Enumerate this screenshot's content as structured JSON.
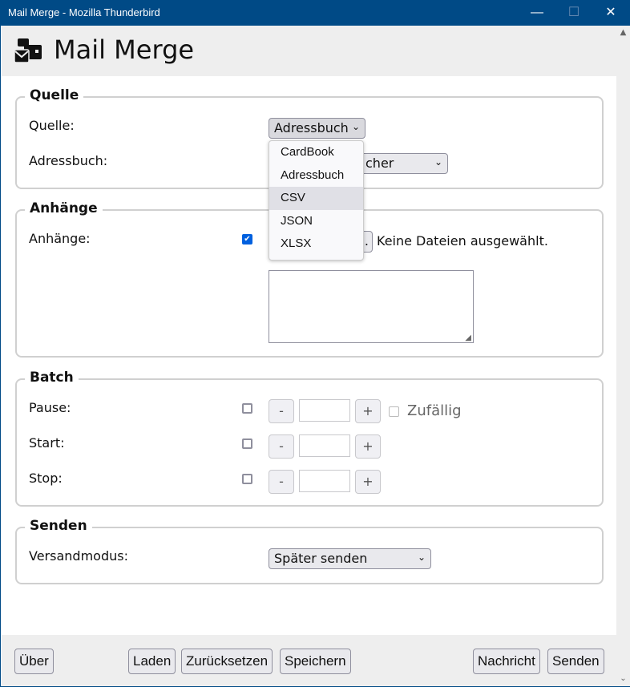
{
  "window": {
    "title": "Mail Merge - Mozilla Thunderbird",
    "minimize": "—",
    "maximize": "☐",
    "close": "✕"
  },
  "header": {
    "title": "Mail Merge",
    "icon": "mail-merge-icon"
  },
  "quelle": {
    "legend": "Quelle",
    "source_label": "Quelle:",
    "source_value": "Adressbuch",
    "addressbook_label": "Adressbuch:",
    "addressbook_value_visible": "cher",
    "options": [
      "CardBook",
      "Adressbuch",
      "CSV",
      "JSON",
      "XLSX"
    ],
    "highlighted": "CSV"
  },
  "anhaenge": {
    "legend": "Anhänge",
    "label": "Anhänge:",
    "checked": true,
    "file_button_visible": ".",
    "file_status": "Keine Dateien ausgewählt."
  },
  "batch": {
    "legend": "Batch",
    "pause": "Pause:",
    "start": "Start:",
    "stop": "Stop:",
    "minus": "-",
    "plus": "+",
    "random": "Zufällig"
  },
  "senden": {
    "legend": "Senden",
    "mode_label": "Versandmodus:",
    "mode_value": "Später senden"
  },
  "footer": {
    "about": "Über",
    "load": "Laden",
    "reset": "Zurücksetzen",
    "save": "Speichern",
    "message": "Nachricht",
    "send": "Senden"
  }
}
